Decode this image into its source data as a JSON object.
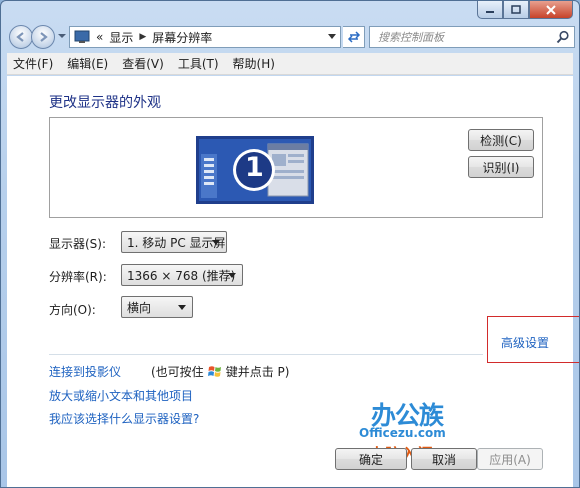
{
  "window": {
    "address": {
      "prefix": "«",
      "crumbs": [
        "显示",
        "屏幕分辨率"
      ]
    },
    "search_placeholder": "搜索控制面板"
  },
  "menu": [
    "文件(F)",
    "编辑(E)",
    "查看(V)",
    "工具(T)",
    "帮助(H)"
  ],
  "page": {
    "title": "更改显示器的外观",
    "monitor_number": "1",
    "detect_label": "检测(C)",
    "identify_label": "识别(I)",
    "display_label": "显示器(S):",
    "display_value": "1. 移动 PC 显示屏",
    "resolution_label": "分辨率(R):",
    "resolution_value": "1366 × 768 (推荐)",
    "orientation_label": "方向(O):",
    "orientation_value": "横向",
    "advanced_label": "高级设置",
    "links": {
      "projector": "连接到投影仪",
      "projector_note_a": "(也可按住",
      "projector_note_b": "键并点击 P)",
      "text_size": "放大或缩小文本和其他项目",
      "which_settings": "我应该选择什么显示器设置?"
    },
    "buttons": {
      "ok": "确定",
      "cancel": "取消",
      "apply": "应用(A)"
    }
  },
  "watermark": {
    "line1": "办公族",
    "line2": "Officezu.com",
    "line3": "电脑入门"
  },
  "colors": {
    "link": "#1e62c0",
    "title": "#1e3287",
    "highlight_box": "#d22b2b",
    "watermark_blue": "#2d8bd6",
    "watermark_orange": "#e05a12"
  }
}
